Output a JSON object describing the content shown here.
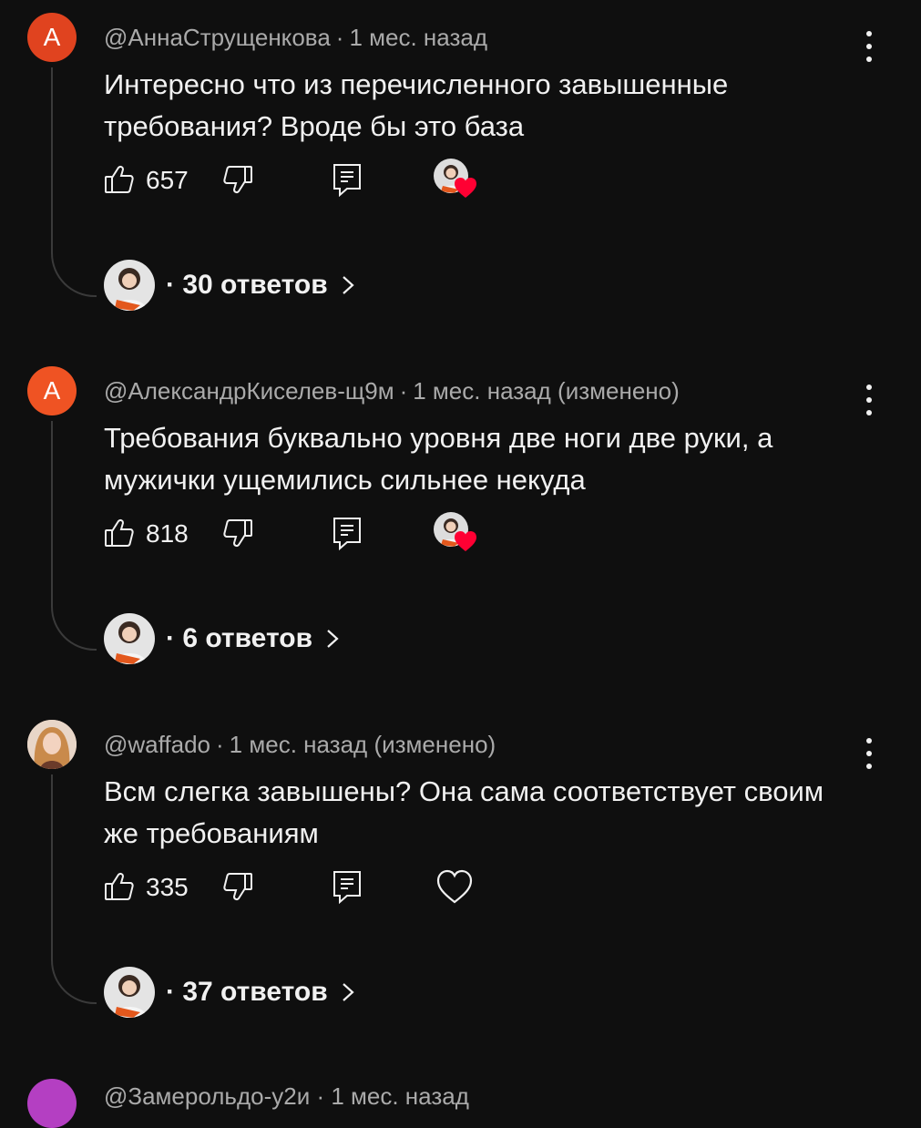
{
  "colors": {
    "background": "#0f0f0f",
    "text": "#f1f1f1",
    "meta": "#aaaaaa",
    "heart_red": "#ff0033"
  },
  "comments": [
    {
      "avatar_letter": "А",
      "avatar_color": "#e0431f",
      "author": "@АннаСтрущенкова",
      "time": "1 мес. назад",
      "edited": "",
      "text": "Интересно что из перечисленного завышенные требования? Вроде бы это база",
      "likes": "657",
      "creator_hearted": true,
      "replies": "30 ответов"
    },
    {
      "avatar_letter": "А",
      "avatar_color": "#ef5323",
      "author": "@АлександрКиселев-щ9м",
      "time": "1 мес. назад",
      "edited": "(изменено)",
      "text": "Требования буквально уровня две ноги две руки, а мужички ущемились сильнее некуда",
      "likes": "818",
      "creator_hearted": true,
      "replies": "6 ответов"
    },
    {
      "avatar_letter": "",
      "avatar_color": "#d9b8a0",
      "author": "@waffado",
      "time": "1 мес. назад",
      "edited": "(изменено)",
      "text": "Всм слегка завышены? Она сама соответствует своим же требованиям",
      "likes": "335",
      "creator_hearted": false,
      "replies": "37 ответов"
    }
  ],
  "next_comment": {
    "avatar_color": "#b43fc2",
    "meta": "@Замерольдо-у2и · 1 мес. назад"
  },
  "icons": {
    "like": "thumb-up-icon",
    "dislike": "thumb-down-icon",
    "reply": "reply-icon",
    "heart": "heart-icon",
    "more": "more-vert-icon",
    "chevron": "chevron-right-icon"
  }
}
